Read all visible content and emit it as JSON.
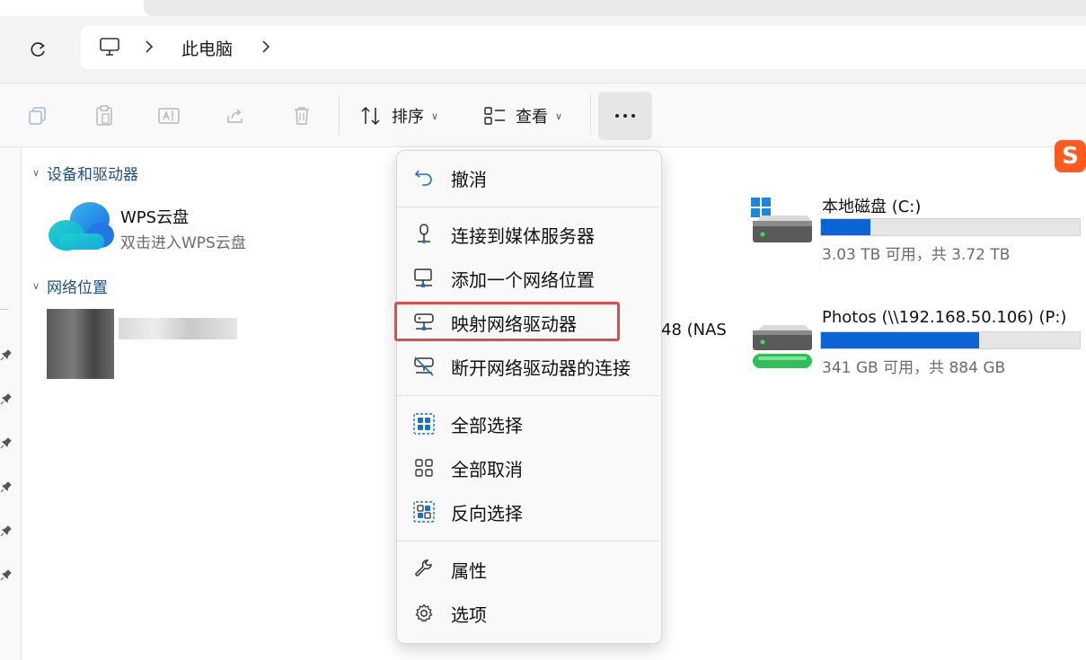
{
  "address_bar": {
    "breadcrumb": "此电脑",
    "icons": [
      "refresh-icon",
      "computer-icon",
      "chevron-right-icon"
    ]
  },
  "toolbar": {
    "icons": [
      "copy-icon",
      "paste-icon",
      "rename-icon",
      "share-icon",
      "delete-icon"
    ],
    "sort_label": "排序",
    "view_label": "查看",
    "more_icon": "more-icon"
  },
  "sections": {
    "devices_header": "设备和驱动器",
    "network_header": "网络位置"
  },
  "wps": {
    "title": "WPS云盘",
    "subtitle": "双击进入WPS云盘"
  },
  "network_item": {
    "partial_name": "48 (NAS"
  },
  "drives": [
    {
      "title": "本地磁盘 (C:)",
      "subtitle": "3.03 TB 可用，共 3.72 TB",
      "used_fraction": 0.19
    },
    {
      "title": "Photos (\\\\192.168.50.106) (P:)",
      "subtitle": "341 GB 可用，共 884 GB",
      "used_fraction": 0.61
    }
  ],
  "menu": {
    "items": [
      {
        "label": "撤消",
        "icon": "undo-icon"
      },
      {
        "label": "连接到媒体服务器",
        "icon": "media-server-icon"
      },
      {
        "label": "添加一个网络位置",
        "icon": "network-location-icon"
      },
      {
        "label": "映射网络驱动器",
        "icon": "map-network-drive-icon",
        "highlighted": true
      },
      {
        "label": "断开网络驱动器的连接",
        "icon": "disconnect-network-drive-icon"
      },
      {
        "label": "全部选择",
        "icon": "select-all-icon"
      },
      {
        "label": "全部取消",
        "icon": "select-none-icon"
      },
      {
        "label": "反向选择",
        "icon": "invert-selection-icon"
      },
      {
        "label": "属性",
        "icon": "properties-icon"
      },
      {
        "label": "选项",
        "icon": "options-icon"
      }
    ]
  },
  "colors": {
    "accent_blue": "#0a64d4",
    "highlight_red": "#e24b4b",
    "sogou_orange": "#ff5a1f"
  },
  "sogou_badge": "S"
}
